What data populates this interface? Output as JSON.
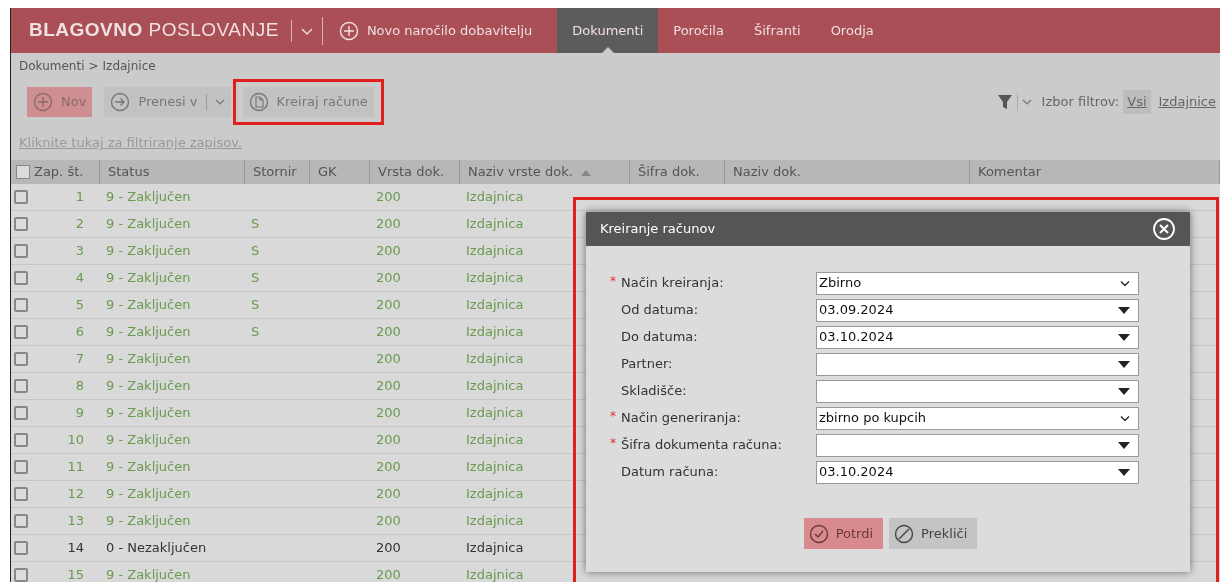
{
  "header": {
    "title": "**BLAGOVNO** POSLOVANJE",
    "new_order": "Novo naročilo dobavitelju",
    "tabs": [
      {
        "label": "Dokumenti",
        "selected": true
      },
      {
        "label": "Poročila",
        "selected": false
      },
      {
        "label": "Šifranti",
        "selected": false
      },
      {
        "label": "Orodja",
        "selected": false
      }
    ]
  },
  "breadcrumb": {
    "items": [
      "Dokumenti",
      "Izdajnice"
    ],
    "separator": ">"
  },
  "toolbar": {
    "buttons": [
      {
        "label": "Nov",
        "kind": "new",
        "highlighted": false
      },
      {
        "label": "Prenesi v",
        "kind": "transfer",
        "highlighted": false
      },
      {
        "label": "Kreiraj račune",
        "kind": "create",
        "highlighted": true
      }
    ],
    "filter_label": "Izbor filtrov:",
    "filters": [
      {
        "label": "Vsi",
        "selected": true
      },
      {
        "label": "Izdajnice",
        "selected": false
      }
    ]
  },
  "filter_link": "Kliknite tukaj za filtriranje zapisov.",
  "table": {
    "select_all_checked": false,
    "columns": [
      {
        "label": "Zap. št.",
        "sorted": false
      },
      {
        "label": "Status",
        "sorted": false
      },
      {
        "label": "Stornir",
        "sorted": false
      },
      {
        "label": "GK",
        "sorted": false
      },
      {
        "label": "Vrsta dok.",
        "sorted": false
      },
      {
        "label": "Naziv vrste dok.",
        "sorted": true
      },
      {
        "label": "Šifra dok.",
        "sorted": false
      },
      {
        "label": "Naziv dok.",
        "sorted": false
      },
      {
        "label": "Komentar",
        "sorted": false
      }
    ],
    "rows": [
      {
        "checked": false,
        "closed": true,
        "no": "1",
        "status": "9 - Zaključen",
        "storno": "",
        "vrsta": "200",
        "naziv_vrste": "Izdajnica"
      },
      {
        "checked": false,
        "closed": true,
        "no": "2",
        "status": "9 - Zaključen",
        "storno": "S",
        "vrsta": "200",
        "naziv_vrste": "Izdajnica"
      },
      {
        "checked": false,
        "closed": true,
        "no": "3",
        "status": "9 - Zaključen",
        "storno": "S",
        "vrsta": "200",
        "naziv_vrste": "Izdajnica"
      },
      {
        "checked": false,
        "closed": true,
        "no": "4",
        "status": "9 - Zaključen",
        "storno": "S",
        "vrsta": "200",
        "naziv_vrste": "Izdajnica"
      },
      {
        "checked": false,
        "closed": true,
        "no": "5",
        "status": "9 - Zaključen",
        "storno": "S",
        "vrsta": "200",
        "naziv_vrste": "Izdajnica"
      },
      {
        "checked": false,
        "closed": true,
        "no": "6",
        "status": "9 - Zaključen",
        "storno": "S",
        "vrsta": "200",
        "naziv_vrste": "Izdajnica"
      },
      {
        "checked": false,
        "closed": true,
        "no": "7",
        "status": "9 - Zaključen",
        "storno": "",
        "vrsta": "200",
        "naziv_vrste": "Izdajnica"
      },
      {
        "checked": false,
        "closed": true,
        "no": "8",
        "status": "9 - Zaključen",
        "storno": "",
        "vrsta": "200",
        "naziv_vrste": "Izdajnica"
      },
      {
        "checked": false,
        "closed": true,
        "no": "9",
        "status": "9 - Zaključen",
        "storno": "",
        "vrsta": "200",
        "naziv_vrste": "Izdajnica"
      },
      {
        "checked": false,
        "closed": true,
        "no": "10",
        "status": "9 - Zaključen",
        "storno": "",
        "vrsta": "200",
        "naziv_vrste": "Izdajnica"
      },
      {
        "checked": false,
        "closed": true,
        "no": "11",
        "status": "9 - Zaključen",
        "storno": "",
        "vrsta": "200",
        "naziv_vrste": "Izdajnica"
      },
      {
        "checked": false,
        "closed": true,
        "no": "12",
        "status": "9 - Zaključen",
        "storno": "",
        "vrsta": "200",
        "naziv_vrste": "Izdajnica"
      },
      {
        "checked": false,
        "closed": true,
        "no": "13",
        "status": "9 - Zaključen",
        "storno": "",
        "vrsta": "200",
        "naziv_vrste": "Izdajnica"
      },
      {
        "checked": false,
        "closed": false,
        "no": "14",
        "status": "0 - Nezaključen",
        "storno": "",
        "vrsta": "200",
        "naziv_vrste": "Izdajnica"
      },
      {
        "checked": false,
        "closed": true,
        "no": "15",
        "status": "9 - Zaključen",
        "storno": "",
        "vrsta": "200",
        "naziv_vrste": "Izdajnica"
      }
    ]
  },
  "dialog": {
    "title": "Kreiranje računov",
    "highlighted": true,
    "required_mark": "*",
    "fields": [
      {
        "label": "Način kreiranja:",
        "required": true,
        "kind": "select",
        "value": "Zbirno"
      },
      {
        "label": "Od datuma:",
        "required": false,
        "kind": "combo",
        "value": "03.09.2024"
      },
      {
        "label": "Do datuma:",
        "required": false,
        "kind": "combo",
        "value": "03.10.2024"
      },
      {
        "label": "Partner:",
        "required": false,
        "kind": "combo"
      },
      {
        "label": "Skladišče:",
        "required": false,
        "kind": "combo"
      },
      {
        "label": "Način generiranja:",
        "required": true,
        "kind": "select",
        "value": "zbirno po kupcih"
      },
      {
        "label": "Šifra dokumenta računa:",
        "required": true,
        "kind": "combo"
      },
      {
        "label": "Datum računa:",
        "required": false,
        "kind": "combo",
        "value": "03.10.2024"
      }
    ],
    "buttons": [
      {
        "label": "Potrdi",
        "kind": "confirm"
      },
      {
        "label": "Prekliči",
        "kind": "cancel"
      }
    ]
  }
}
